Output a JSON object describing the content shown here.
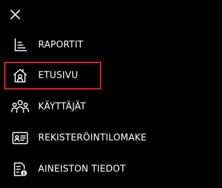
{
  "menu": {
    "close_icon": "close-icon",
    "items": [
      {
        "label": "RAPORTIT",
        "icon": "report-chart-icon"
      },
      {
        "label": "ETUSIVU",
        "icon": "home-person-icon",
        "highlighted": true
      },
      {
        "label": "KÄYTTÄJÄT",
        "icon": "users-icon"
      },
      {
        "label": "REKISTERÖINTILOMAKE",
        "icon": "registration-card-icon"
      },
      {
        "label": "AINEISTON TIEDOT",
        "icon": "document-info-icon"
      }
    ]
  },
  "colors": {
    "background": "#000000",
    "text": "#ffffff",
    "highlight_border": "#e11d2e"
  }
}
